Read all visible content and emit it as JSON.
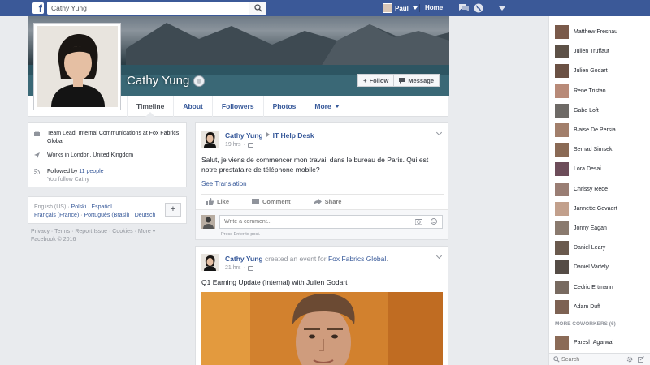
{
  "topbar": {
    "search_value": "Cathy Yung",
    "user_name": "Paul",
    "home_label": "Home"
  },
  "profile": {
    "name": "Cathy Yung",
    "follow_label": "Follow",
    "message_label": "Message",
    "tabs": [
      "Timeline",
      "About",
      "Followers",
      "Photos",
      "More"
    ]
  },
  "intro": {
    "job": "Team Lead, Internal Communications at Fox Fabrics Global",
    "location": "Works in London, United Kingdom",
    "followed_prefix": "Followed by ",
    "followed_count": "11 people",
    "you_follow": "You follow Cathy"
  },
  "languages": {
    "current": "English (US)",
    "items": [
      "Polski",
      "Español",
      "Français (France)",
      "Português (Brasil)",
      "Deutsch"
    ],
    "add_label": "+"
  },
  "footer": {
    "links": [
      "Privacy",
      "Terms",
      "Report Issue",
      "Cookies",
      "More"
    ],
    "copyright": "Facebook © 2016"
  },
  "post1": {
    "author": "Cathy Yung",
    "target": "IT Help Desk",
    "time": "19 hrs",
    "body": "Salut, je viens de commencer mon travail dans le bureau de Paris. Qui est notre prestataire de téléphone mobile?",
    "translate": "See Translation",
    "like": "Like",
    "comment": "Comment",
    "share": "Share",
    "comment_placeholder": "Write a comment...",
    "comment_hint": "Press Enter to post."
  },
  "post2": {
    "author": "Cathy Yung",
    "action": " created an event for ",
    "group": "Fox Fabrics Global",
    "period": ".",
    "time": "21 hrs",
    "title": "Q1 Earning Update (Internal) with Julien Godart"
  },
  "chat": {
    "people": [
      "Matthew Fresnau",
      "Julien Truffaut",
      "Julien Godart",
      "Rene Tristan",
      "Gabe Loft",
      "Blaise De Persia",
      "Serhad Simsek",
      "Lora Desai",
      "Chrissy Rede",
      "Jannette Gevaert",
      "Jonny Eagan",
      "Daniel Leary",
      "Daniel Vartely",
      "Cedric Ertmann",
      "Adam Duff"
    ],
    "more_label": "MORE COWORKERS (6)",
    "extra": "Paresh Agarwal",
    "search_placeholder": "Search"
  }
}
